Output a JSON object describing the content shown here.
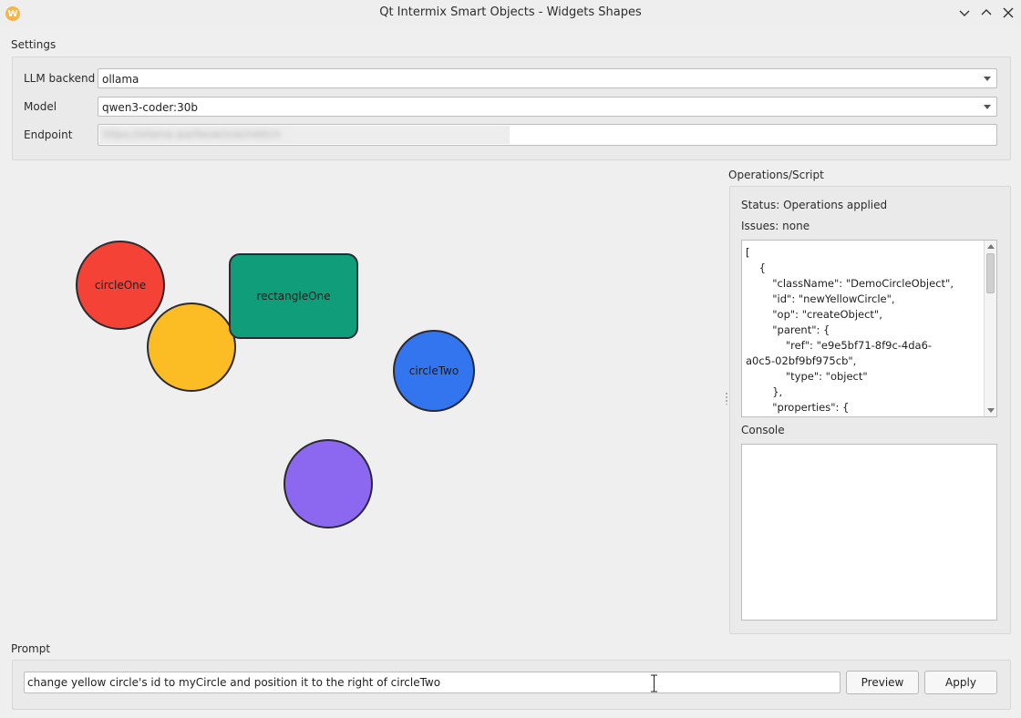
{
  "window": {
    "title": "Qt Intermix Smart Objects - Widgets Shapes",
    "icon_letter": "W",
    "icon": "app-icon"
  },
  "settings": {
    "group_label": "Settings",
    "llm_backend": {
      "label": "LLM backend",
      "value": "ollama"
    },
    "model": {
      "label": "Model",
      "value": "qwen3-coder:30b"
    },
    "endpoint": {
      "label": "Endpoint",
      "value": "https://ollama.ipa/0ezw/o/ai/mbf/ch"
    }
  },
  "canvas": {
    "shapes": [
      {
        "name": "circleOne",
        "label": "circleOne",
        "kind": "circle",
        "color": "#f44336"
      },
      {
        "name": "yellowCircle",
        "label": "",
        "kind": "circle",
        "color": "#fbbc24"
      },
      {
        "name": "rectangleOne",
        "label": "rectangleOne",
        "kind": "rect",
        "color": "#0f9d7a"
      },
      {
        "name": "circleTwo",
        "label": "circleTwo",
        "kind": "circle",
        "color": "#3275ee"
      },
      {
        "name": "purpleCircle",
        "label": "",
        "kind": "circle",
        "color": "#8b68ef"
      }
    ]
  },
  "operations": {
    "group_label": "Operations/Script",
    "status": "Status: Operations applied",
    "issues": "Issues: none",
    "script_lines": [
      "[",
      "    {",
      "        \"className\": \"DemoCircleObject\",",
      "        \"id\": \"newYellowCircle\",",
      "        \"op\": \"createObject\",",
      "        \"parent\": {",
      "            \"ref\": \"e9e5bf71-8f9c-4da6-",
      "a0c5-02bf9bf975cb\",",
      "            \"type\": \"object\"",
      "        },",
      "        \"properties\": {"
    ],
    "console_label": "Console",
    "console_text": ""
  },
  "prompt": {
    "group_label": "Prompt",
    "value": "change yellow circle's id to myCircle and position it to the right of circleTwo",
    "preview_label": "Preview",
    "apply_label": "Apply"
  },
  "colors": {
    "background": "#efefef",
    "stroke": "#2a2a33"
  }
}
